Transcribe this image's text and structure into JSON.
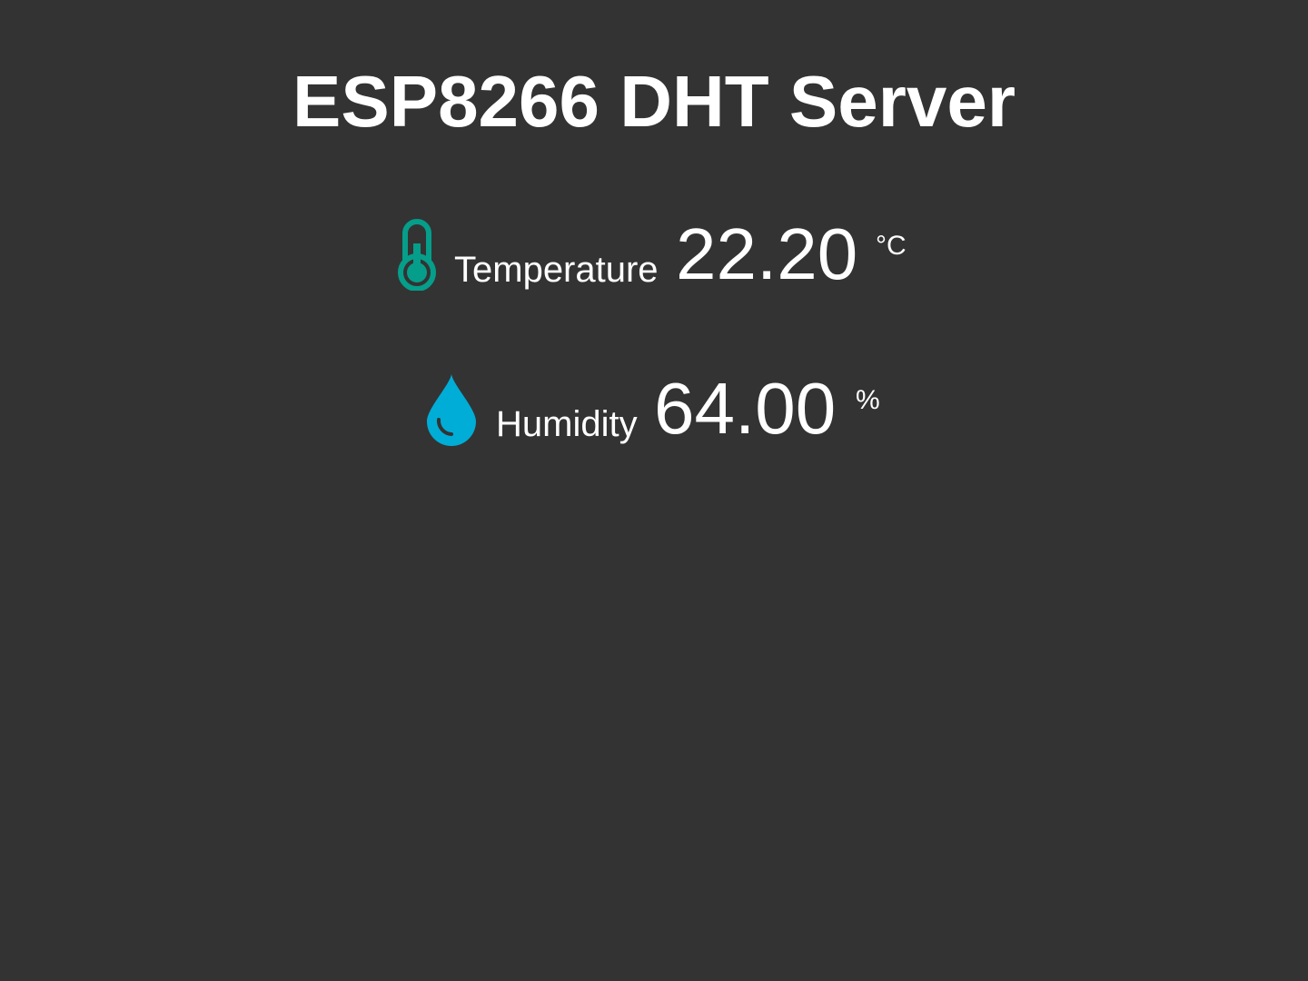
{
  "header": {
    "title": "ESP8266 DHT Server"
  },
  "readings": [
    {
      "icon": "thermometer-icon",
      "icon_color": "#059e8a",
      "label": "Temperature",
      "value": "22.20",
      "unit": "°C"
    },
    {
      "icon": "water-drop-icon",
      "icon_color": "#00add6",
      "label": "Humidity",
      "value": "64.00",
      "unit": "%"
    }
  ],
  "colors": {
    "background": "#333333",
    "text": "#ffffff"
  }
}
